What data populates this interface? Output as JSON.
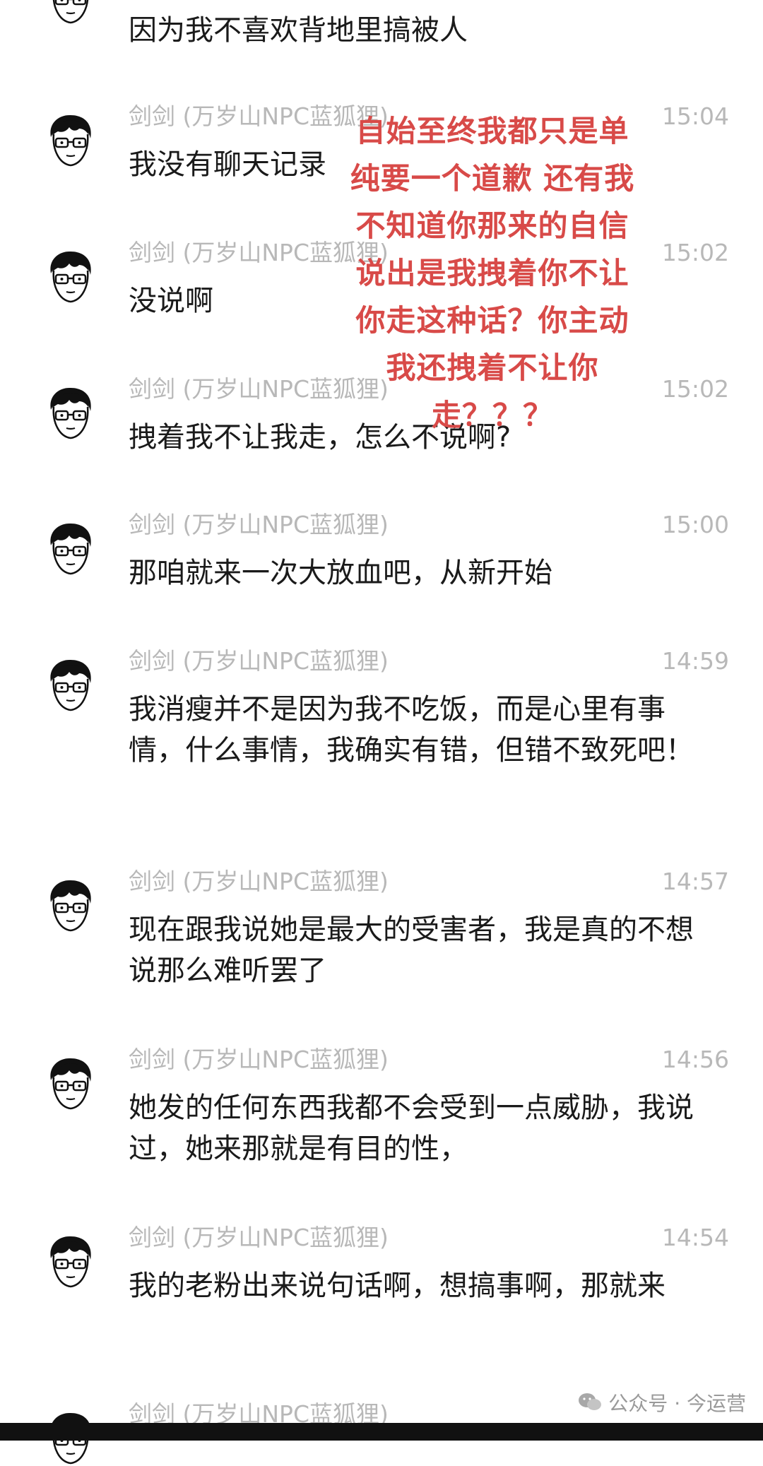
{
  "messages": [
    {
      "name": "",
      "time": "",
      "text": "因为我不喜欢背地里搞被人"
    },
    {
      "name": "剑剑 (万岁山NPC蓝狐狸)",
      "time": "15:04",
      "text": "我没有聊天记录"
    },
    {
      "name": "剑剑 (万岁山NPC蓝狐狸)",
      "time": "15:02",
      "text": "没说啊"
    },
    {
      "name": "剑剑 (万岁山NPC蓝狐狸)",
      "time": "15:02",
      "text": "拽着我不让我走，怎么不说啊?"
    },
    {
      "name": "剑剑 (万岁山NPC蓝狐狸)",
      "time": "15:00",
      "text": "那咱就来一次大放血吧，从新开始"
    },
    {
      "name": "剑剑 (万岁山NPC蓝狐狸)",
      "time": "14:59",
      "text": "我消瘦并不是因为我不吃饭，而是心里有事情，什么事情，我确实有错，但错不致死吧！"
    },
    {
      "name": "剑剑 (万岁山NPC蓝狐狸)",
      "time": "14:57",
      "text": "现在跟我说她是最大的受害者，我是真的不想说那么难听罢了"
    },
    {
      "name": "剑剑 (万岁山NPC蓝狐狸)",
      "time": "14:56",
      "text": "她发的任何东西我都不会受到一点威胁，我说过，她来那就是有目的性，"
    },
    {
      "name": "剑剑 (万岁山NPC蓝狐狸)",
      "time": "14:54",
      "text": "我的老粉出来说句话啊，想搞事啊，那就来"
    },
    {
      "name": "剑剑 (万岁山NPC蓝狐狸)",
      "time": "",
      "text": ""
    }
  ],
  "overlay": {
    "lines": [
      "自始至终我都只是单",
      "纯要一个道歉 还有我",
      "不知道你那来的自信",
      "说出是我拽着你不让",
      "你走这种话？你主动",
      "我还拽着不让你",
      "走？？？"
    ],
    "color": "#d84a48"
  },
  "watermark": {
    "icon": "wechat-icon",
    "text": "公众号 · 今运营"
  },
  "colors": {
    "meta": "#b8b8b8",
    "text": "#1a1a1a",
    "background": "#ffffff"
  }
}
